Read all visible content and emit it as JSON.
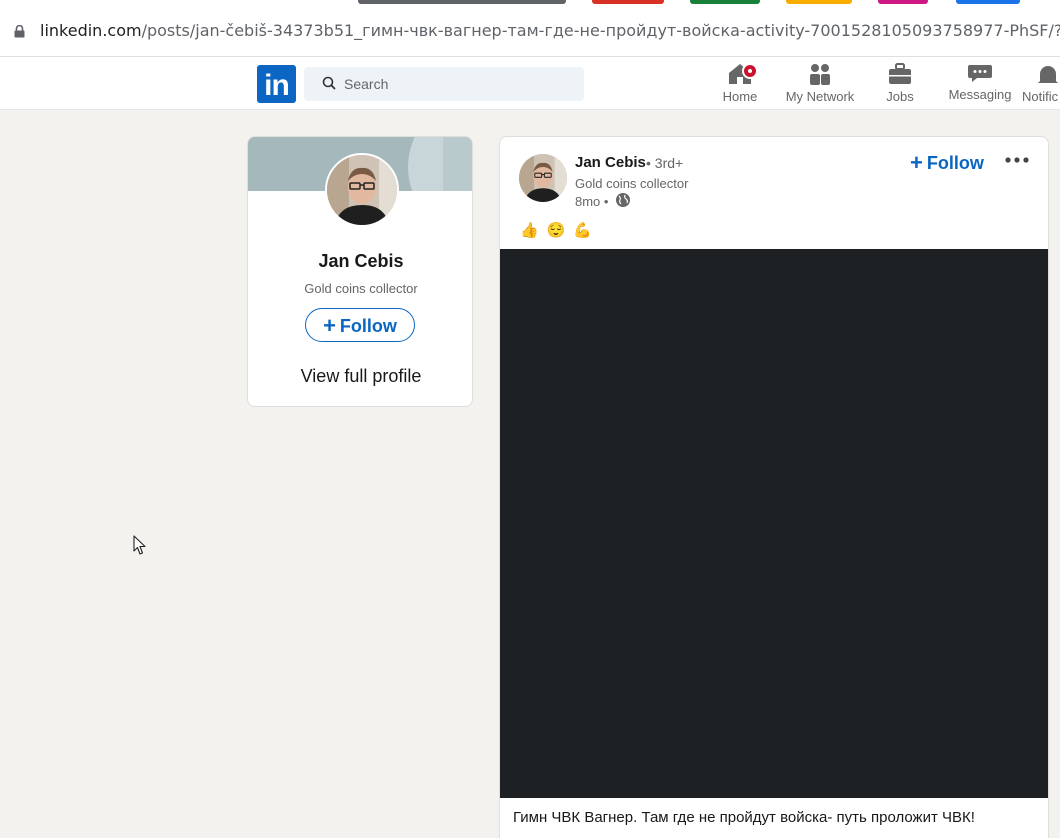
{
  "browser": {
    "url_host": "linkedin.com",
    "url_path": "/posts/jan-čebiš-34373b51_гимн-чвк-вагнер-там-где-не-пройдут-войска-activity-7001528105093758977-PhSF/?utm_",
    "tab_colors": [
      "#5f6368",
      "#d93025",
      "#188038",
      "#f9ab00",
      "#d01884",
      "#1a73e8"
    ]
  },
  "nav": {
    "logo_text": "in",
    "search_placeholder": "Search",
    "items": [
      {
        "label": "Home",
        "icon": "home-icon"
      },
      {
        "label": "My Network",
        "icon": "network-icon"
      },
      {
        "label": "Jobs",
        "icon": "jobs-icon"
      },
      {
        "label": "Messaging",
        "icon": "messaging-icon"
      },
      {
        "label": "Notific",
        "icon": "bell-icon"
      }
    ]
  },
  "profile": {
    "name": "Jan Cebis",
    "headline": "Gold coins collector",
    "follow_label": "Follow",
    "view_profile_label": "View full profile"
  },
  "post": {
    "author": "Jan Cebis",
    "degree": "• 3rd+",
    "headline": "Gold coins collector",
    "time": "8mo •",
    "follow_label": "Follow",
    "reactions": "👍😌💪",
    "caption": "Гимн ЧВК Вагнер. Там где не пройдут войска- путь проложит ЧВК!"
  },
  "colors": {
    "brand": "#0a66c2",
    "page_bg": "#f3f2ef",
    "video_bg": "#1e2124",
    "badge": "#cb112d"
  }
}
